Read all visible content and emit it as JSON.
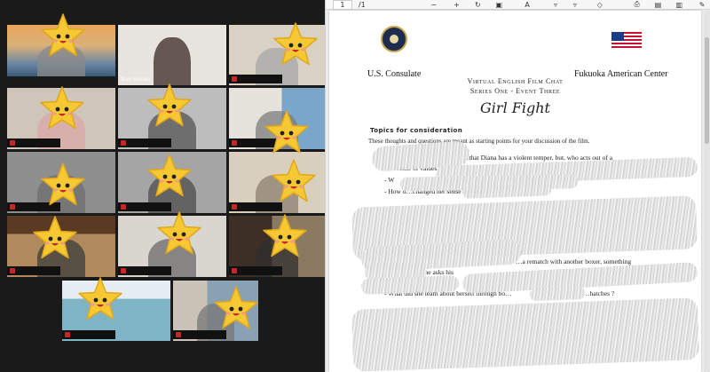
{
  "gallery": {
    "participant_label": "Nao Suzuki",
    "colors": {
      "background": "#1a1a1a",
      "active_border": "#b7e34a",
      "muted": "#c62828",
      "star": "#f6c833"
    }
  },
  "viewer": {
    "toolbar": {
      "page_current": "1",
      "page_total": "/1",
      "icons": [
        "zoom-out-icon",
        "zoom-in-icon",
        "rotate-icon",
        "fit-page-icon",
        "read-aloud-icon",
        "draw-icon",
        "highlight-icon",
        "erase-icon",
        "print-icon",
        "save-icon",
        "save-as-icon",
        "pin-icon"
      ]
    },
    "document": {
      "left_org": "U.S. Consulate",
      "right_org": "Fukuoka American Center",
      "heading1": "Virtual English Film Chat",
      "heading2": "Series One - Event Three",
      "film_title": "Girl Fight",
      "topics_heading": "Topics for consideration",
      "intro": "These thoughts and questions are meant as starting points for your discussion of the film.",
      "line_a": "…that Diana has a violent temper, but, who acts out of a",
      "line_b": "sense of values.",
      "bullet_1": "W",
      "bullet_2": "How d…changed her sense of values ?",
      "line_c": "…a rematch with another boxer, something",
      "line_d": "…he asks his",
      "bullet_3": "What did she learn about herself through bo…",
      "bullet_3_end": "…hatches ?"
    }
  }
}
